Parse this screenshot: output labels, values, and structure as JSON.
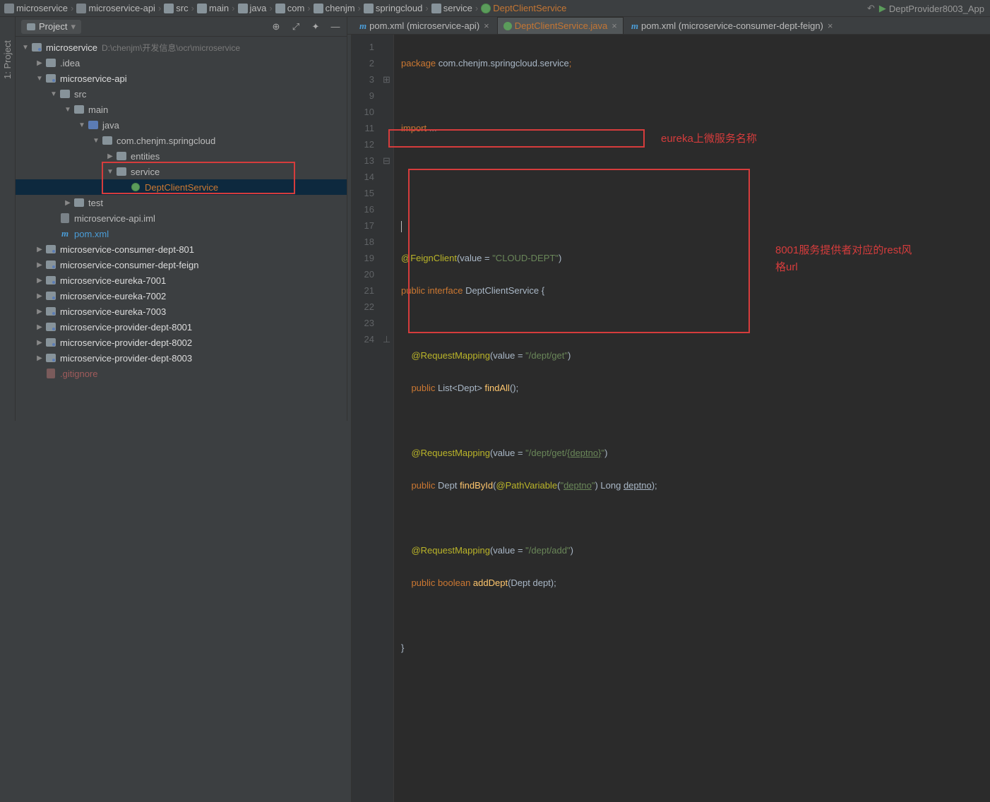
{
  "breadcrumb": [
    "microservice",
    "microservice-api",
    "src",
    "main",
    "java",
    "com",
    "chenjm",
    "springcloud",
    "service",
    "DeptClientService"
  ],
  "run_config": "DeptProvider8003_App",
  "sidebar_vert": "1: Project",
  "project_title": "Project",
  "tree": {
    "root": "microservice",
    "root_path": "D:\\chenjm\\开发信息\\ocr\\microservice",
    "idea": ".idea",
    "api": "microservice-api",
    "src": "src",
    "main": "main",
    "java": "java",
    "pkg": "com.chenjm.springcloud",
    "entities": "entities",
    "service": "service",
    "dcs": "DeptClientService",
    "test": "test",
    "iml": "microservice-api.iml",
    "pom": "pom.xml",
    "mods": [
      "microservice-consumer-dept-801",
      "microservice-consumer-dept-feign",
      "microservice-eureka-7001",
      "microservice-eureka-7002",
      "microservice-eureka-7003",
      "microservice-provider-dept-8001",
      "microservice-provider-dept-8002",
      "microservice-provider-dept-8003"
    ],
    "gitignore": ".gitignore"
  },
  "tabs": [
    {
      "label": "pom.xml (microservice-api)",
      "icon": "m",
      "active": false
    },
    {
      "label": "DeptClientService.java",
      "icon": "i",
      "active": true
    },
    {
      "label": "pom.xml (microservice-consumer-dept-feign)",
      "icon": "m",
      "active": false
    }
  ],
  "gutter": [
    "1",
    "2",
    "3",
    "9",
    "",
    "10",
    "11",
    "12",
    "13",
    "14",
    "15",
    "16",
    "17",
    "18",
    "19",
    "20",
    "21",
    "22",
    "23",
    "24"
  ],
  "code": {
    "l1a": "package",
    "l1b": " com.chenjm.springcloud.service",
    "l3a": "import ",
    "l3b": "...",
    "l11a": "@FeignClient",
    "l11b": "(value = ",
    "l11c": "\"CLOUD-DEPT\"",
    "l11d": ")",
    "l12a": "public interface ",
    "l12b": "DeptClientService {",
    "l14a": "@RequestMapping",
    "l14b": "(value = ",
    "l14c": "\"/dept/get\"",
    "l14d": ")",
    "l15a": "public ",
    "l15b": "List<Dept> ",
    "l15c": "findAll",
    "l15d": "();",
    "l17a": "@RequestMapping",
    "l17b": "(value = ",
    "l17c": "\"/dept/get/",
    "l17cu": "{deptno}",
    "l17ce": "\"",
    "l17d": ")",
    "l18a": "public ",
    "l18b": "Dept ",
    "l18c": "findById",
    "l18d": "(",
    "l18e": "@PathVariable",
    "l18f": "(",
    "l18g": "\"",
    "l18gu": "deptno",
    "l18ge": "\"",
    "l18h": ") Long ",
    "l18hu": "deptno",
    "l18i": ");",
    "l20a": "@RequestMapping",
    "l20b": "(value = ",
    "l20c": "\"/dept/add\"",
    "l20d": ")",
    "l21a": "public boolean ",
    "l21c": "addDept",
    "l21d": "(Dept dept);",
    "l23": "}"
  },
  "annotation1": "eureka上微服务名称",
  "annotation2a": "8001服务提供者对应的rest风",
  "annotation2b": "格url"
}
